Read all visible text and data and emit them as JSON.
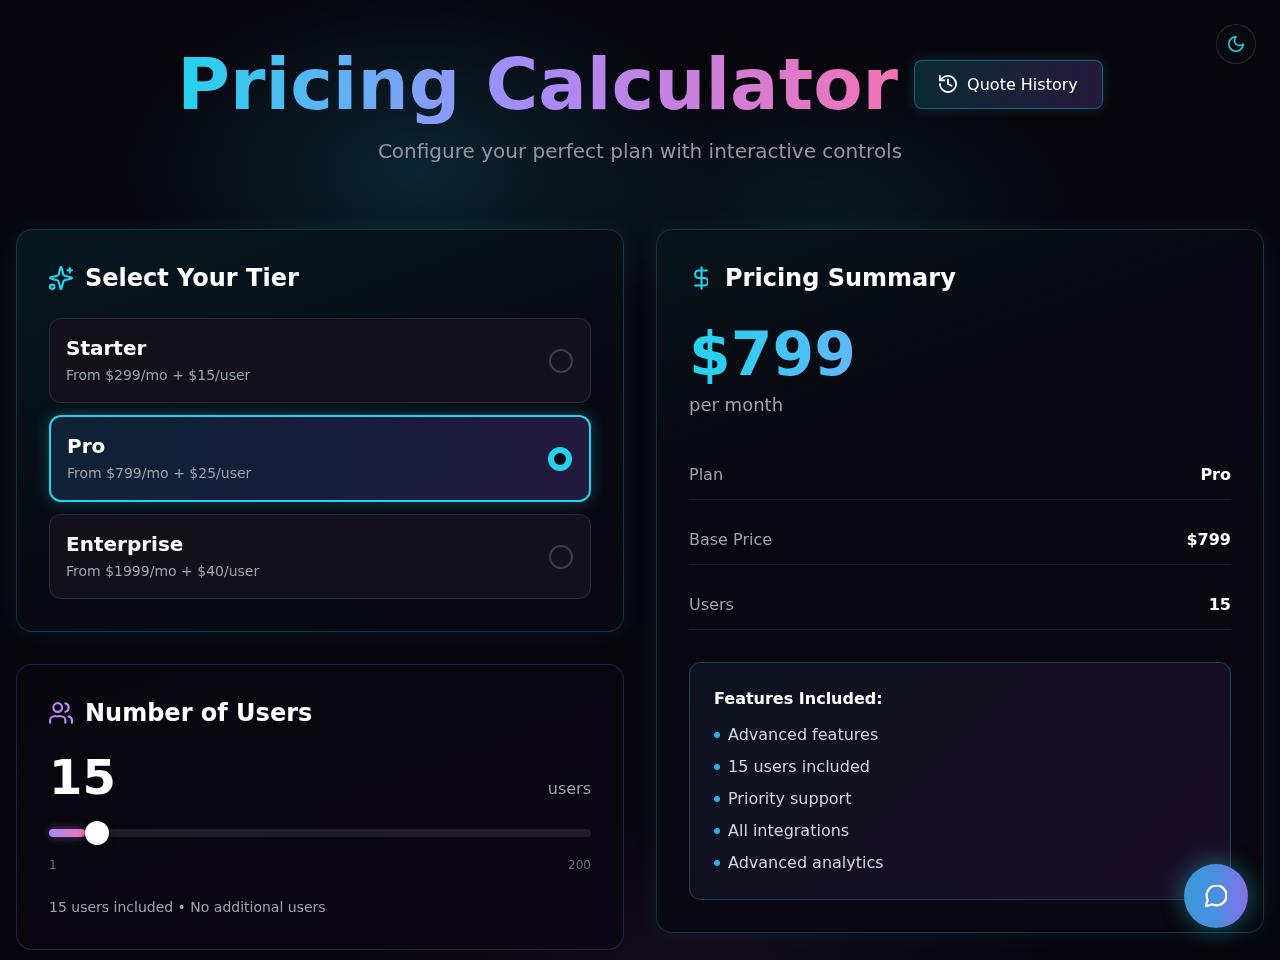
{
  "header": {
    "title": "Pricing Calculator",
    "quote_history_button": "Quote History",
    "subtitle": "Configure your perfect plan with interactive controls"
  },
  "tier_panel": {
    "title": "Select Your Tier",
    "tiers": [
      {
        "name": "Starter",
        "price": "From $299/mo + $15/user",
        "selected": false
      },
      {
        "name": "Pro",
        "price": "From $799/mo + $25/user",
        "selected": true
      },
      {
        "name": "Enterprise",
        "price": "From $1999/mo + $40/user",
        "selected": false
      }
    ]
  },
  "users_panel": {
    "title": "Number of Users",
    "count": "15",
    "unit": "users",
    "slider": {
      "level": 0.07,
      "min_label": "1",
      "max_label": "200"
    },
    "note": "15 users included • No additional users"
  },
  "summary_panel": {
    "title": "Pricing Summary",
    "price": "$799",
    "period": "per month",
    "rows": [
      {
        "label": "Plan",
        "value": "Pro"
      },
      {
        "label": "Base Price",
        "value": "$799"
      },
      {
        "label": "Users",
        "value": "15"
      }
    ],
    "features": {
      "title": "Features Included:",
      "items": [
        "Advanced features",
        "15 users included",
        "Priority support",
        "All integrations",
        "Advanced analytics"
      ]
    }
  }
}
